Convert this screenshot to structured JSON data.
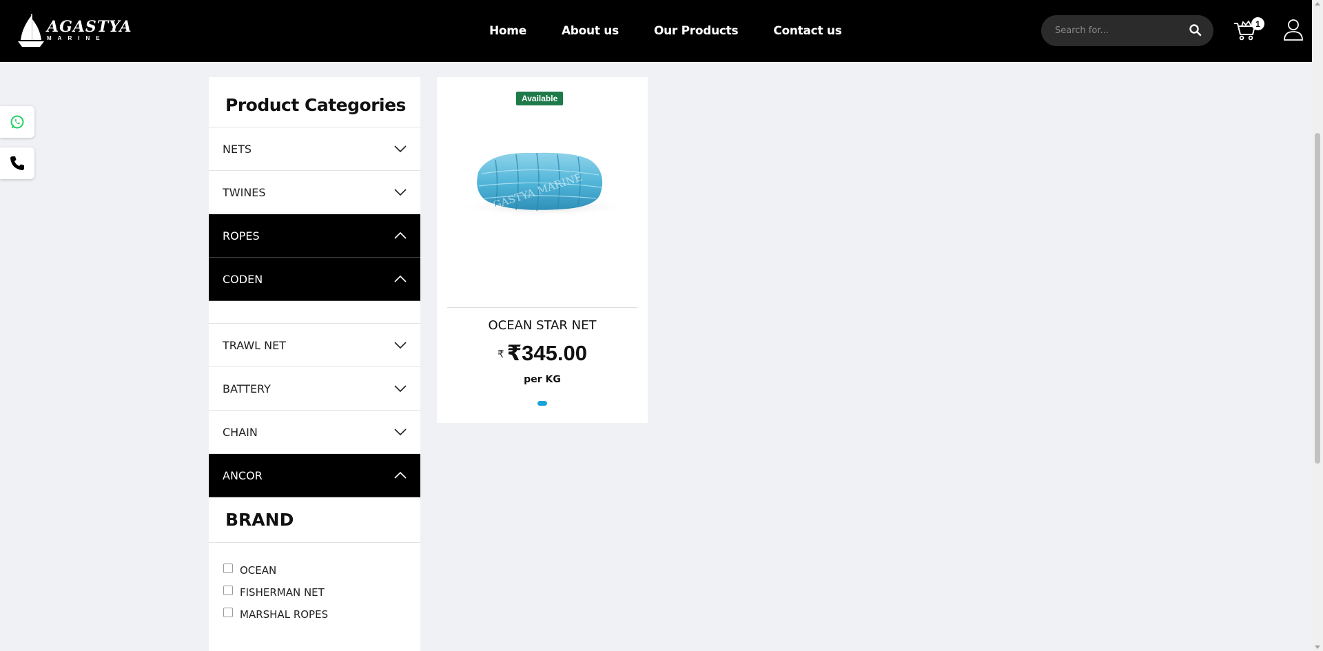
{
  "header": {
    "logo_main": "AGASTYA",
    "logo_sub": "MARINE",
    "nav": [
      "Home",
      "About us",
      "Our Products",
      "Contact us"
    ],
    "search_placeholder": "Search for...",
    "cart_count": "1"
  },
  "sidebar": {
    "title": "Product Categories",
    "categories": [
      {
        "label": "NETS",
        "expanded": false
      },
      {
        "label": "TWINES",
        "expanded": false
      },
      {
        "label": "ROPES",
        "expanded": true
      },
      {
        "label": "CODEN",
        "expanded": true
      },
      {
        "label": "TRAWL NET",
        "expanded": false
      },
      {
        "label": "BATTERY",
        "expanded": false
      },
      {
        "label": "CHAIN",
        "expanded": false
      },
      {
        "label": "ANCOR",
        "expanded": true
      }
    ],
    "brand_title": "BRAND",
    "brands": [
      "OCEAN",
      "FISHERMAN NET",
      "MARSHAL ROPES"
    ]
  },
  "product": {
    "badge": "Available",
    "name": "OCEAN STAR NET",
    "currency_symbol": "₹",
    "price": "₹345.00",
    "unit": "per KG",
    "watermark": "AGASTYA MARINE"
  },
  "colors": {
    "header_bg": "#000000",
    "badge_bg": "#1f7a4a",
    "carousel_dot": "#1aa3d9",
    "whatsapp": "#25d366"
  },
  "icons": {
    "search": "search-icon",
    "cart": "cart-icon",
    "user": "user-icon",
    "whatsapp": "whatsapp-icon",
    "phone": "phone-icon",
    "chevron_down": "chevron-down-icon",
    "chevron_up": "chevron-up-icon"
  }
}
